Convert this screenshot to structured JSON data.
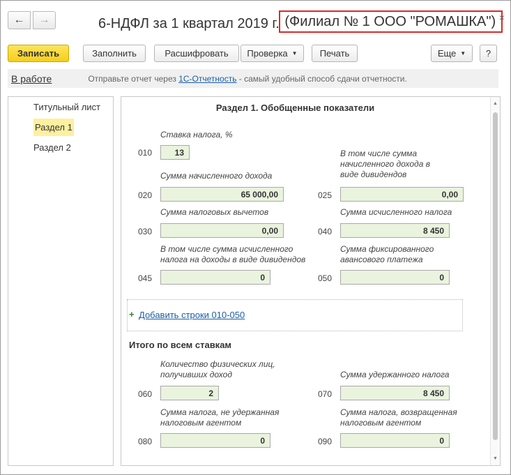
{
  "title": {
    "main": "6-НДФЛ за 1 квартал 2019 г.",
    "org": "(Филиал № 1 ООО \"РОМАШКА\")"
  },
  "icons": {
    "back": "←",
    "forward": "→",
    "close": "×"
  },
  "toolbar": {
    "save": "Записать",
    "fill": "Заполнить",
    "decode": "Расшифровать",
    "check": "Проверка",
    "print": "Печать",
    "more": "Еще",
    "help": "?"
  },
  "infobar": {
    "status": "В работе",
    "hint_prefix": "Отправьте отчет через",
    "hint_link": "1С-Отчетность",
    "hint_suffix": "- самый удобный способ сдачи отчетности."
  },
  "sidebar": {
    "items": [
      {
        "label": "Титульный лист",
        "active": false
      },
      {
        "label": "Раздел 1",
        "active": true
      },
      {
        "label": "Раздел 2",
        "active": false
      }
    ]
  },
  "section": {
    "title": "Раздел 1. Обобщенные показатели",
    "f010": {
      "caption": "Ставка налога, %",
      "code": "010",
      "value": "13"
    },
    "f020": {
      "caption": "Сумма начисленного дохода",
      "code": "020",
      "value": "65 000,00"
    },
    "f025": {
      "caption": "В том числе сумма начисленного дохода в виде дивидендов",
      "code": "025",
      "value": "0,00"
    },
    "f030": {
      "caption": "Сумма налоговых вычетов",
      "code": "030",
      "value": "0,00"
    },
    "f040": {
      "caption": "Сумма исчисленного налога",
      "code": "040",
      "value": "8 450"
    },
    "f045": {
      "caption": "В том числе сумма исчисленного налога на доходы в виде дивидендов",
      "code": "045",
      "value": "0"
    },
    "f050": {
      "caption": "Сумма фиксированного авансового платежа",
      "code": "050",
      "value": "0"
    },
    "add_link": "Добавить строки 010-050",
    "totals_title": "Итого по всем ставкам",
    "f060": {
      "caption": "Количество физических лиц, получивших доход",
      "code": "060",
      "value": "2"
    },
    "f070": {
      "caption": "Сумма удержанного налога",
      "code": "070",
      "value": "8 450"
    },
    "f080": {
      "caption": "Сумма налога, не удержанная налоговым агентом",
      "code": "080",
      "value": "0"
    },
    "f090": {
      "caption": "Сумма налога, возвращенная налоговым агентом",
      "code": "090",
      "value": "0"
    }
  },
  "colors": {
    "primary_button": "#f5cf1b",
    "field_bg": "#e9f3de",
    "org_highlight": "#d62b2b",
    "link": "#1a5ea8",
    "active_tab": "#fdf0a0"
  }
}
